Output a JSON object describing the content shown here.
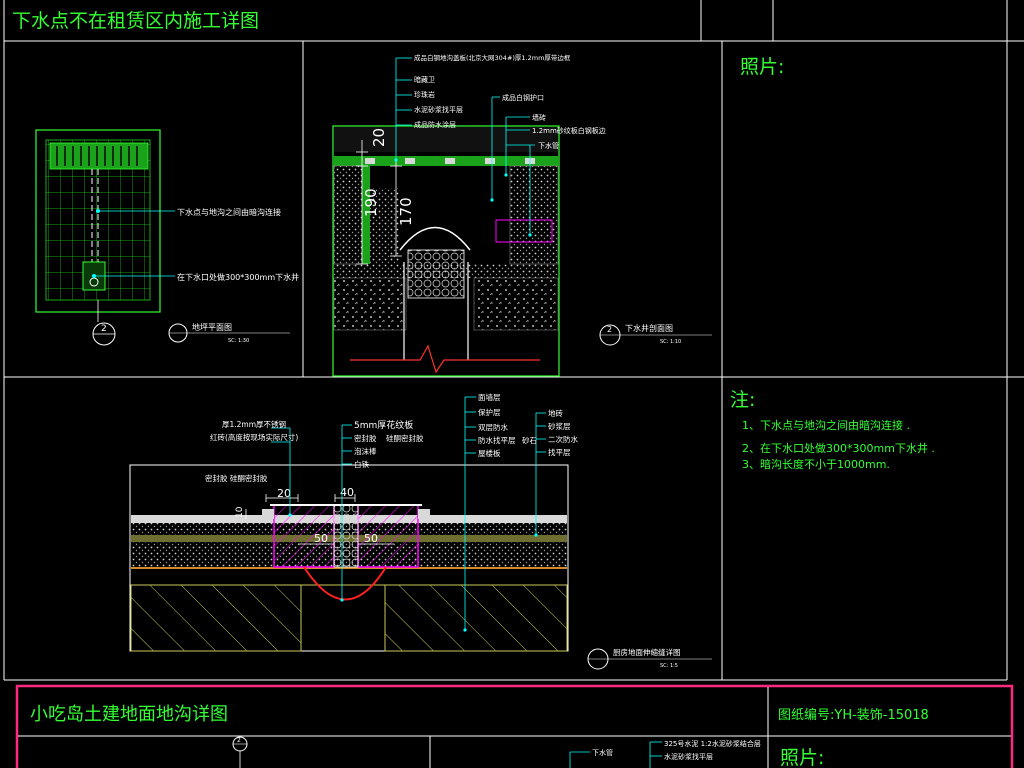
{
  "sheet": {
    "title": "下水点不在租赁区内施工详图",
    "photo_label": "照片:",
    "notes_title": "注:",
    "notes": [
      "1、下水点与地沟之间由暗沟连接 .",
      "2、在下水口处做300*300mm下水井 .",
      "3、暗沟长度不小于1000mm."
    ]
  },
  "plan_view": {
    "callout_1": "下水点与地沟之间由暗沟连接",
    "callout_2": "在下水口处做300*300mm下水井",
    "tag_number": "2",
    "caption": "地坪平面图",
    "scale": "SC:  1:30"
  },
  "well_section": {
    "labels_left": [
      "成品白钢地沟盖板(北京大网304#)厚1.2mm厚带边框",
      "暗藏卫",
      "珍珠岩",
      "水泥砂浆找平层",
      "成品防水涂层"
    ],
    "label_mid": "成品白钢护口",
    "labels_right": [
      "墙砖",
      "1.2mm砂纹板白钢板边",
      "下水管"
    ],
    "dims": [
      "20",
      "190",
      "170"
    ],
    "tag_number": "2",
    "caption": "下水井剖面图",
    "scale": "SC:  1:10"
  },
  "joint_detail": {
    "labels_left": [
      "厚1.2mm厚不锈钢",
      "红砖(高度按现场实际尺寸)"
    ],
    "label_seal": "密封胶   硅酮密封胶",
    "labels_center": [
      "5mm厚花纹板",
      "密封胶",
      "硅酮密封胶",
      "泡沫棒",
      "白铁"
    ],
    "labels_layers": [
      "面墙层",
      "保护层",
      "双层防水",
      "防水找平层",
      "屋楼板"
    ],
    "labels_right": [
      "地砖",
      "砂浆层",
      "二次防水",
      "找平层"
    ],
    "label_stone": "砂石",
    "dims": [
      "20",
      "40",
      "50",
      "50",
      "10"
    ],
    "caption": "厨房地面伸缩缝详图",
    "scale": "SC:  1:5"
  },
  "next_sheet": {
    "title": "小吃岛土建地面地沟详图",
    "drawing_no": "图纸编号:YH-装饰-15018",
    "photo_label": "照片:",
    "tag_number": "2",
    "snippet_1": "325号水泥 1:2水泥砂浆结合层",
    "snippet_2": "水泥砂浆找平层",
    "snippet_3": "下水管"
  },
  "colors": {
    "frame": "#ffffff",
    "title_text": "#33ff33",
    "leader": "#00ffff",
    "dimension": "#ffffff",
    "section": "#ff00ff",
    "accent": "#ff2a7f",
    "ground_hatch": "#c9c957",
    "layer_fill": "#505050",
    "highlight": "#ff3030"
  }
}
